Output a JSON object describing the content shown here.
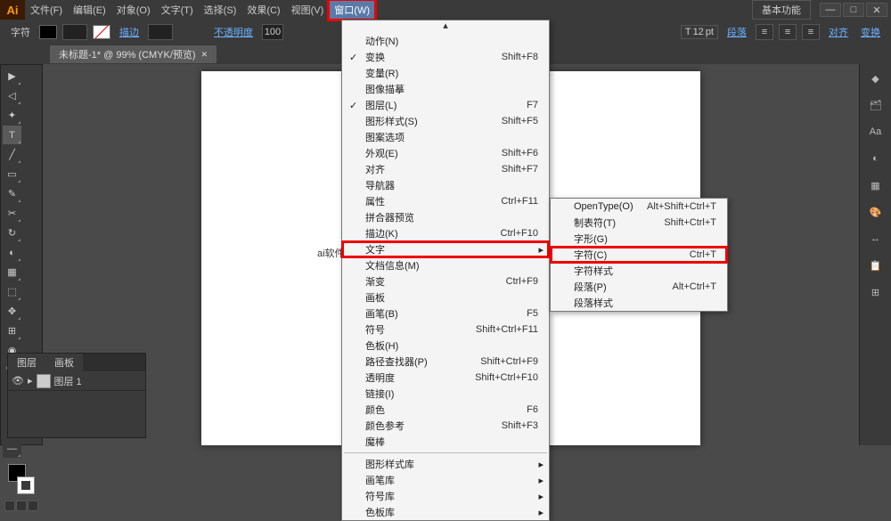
{
  "app": {
    "logo": "Ai",
    "essentials": "基本功能"
  },
  "menu": {
    "items": [
      "文件(F)",
      "编辑(E)",
      "对象(O)",
      "文字(T)",
      "选择(S)",
      "效果(C)",
      "视图(V)",
      "窗口(W)"
    ],
    "activeIndex": 7
  },
  "optionbar": {
    "charLabel": "字符",
    "strokeLabel": "描边",
    "opacityLabel": "不透明度",
    "opacityValue": "100",
    "fontSize": "12",
    "fontUnit": "pt",
    "paragraphLink": "段落",
    "alignLink": "对齐",
    "transformLink": "变换"
  },
  "doc": {
    "tabTitle": "未标题-1* @ 99% (CMYK/预览)",
    "canvasText": "ai软件的:"
  },
  "windowMenu": {
    "items": [
      {
        "label": "动作(N)"
      },
      {
        "label": "变换",
        "shortcut": "Shift+F8",
        "checked": true
      },
      {
        "label": "变量(R)"
      },
      {
        "label": "图像描摹"
      },
      {
        "label": "图层(L)",
        "shortcut": "F7",
        "checked": true
      },
      {
        "label": "图形样式(S)",
        "shortcut": "Shift+F5"
      },
      {
        "label": "图案选项"
      },
      {
        "label": "外观(E)",
        "shortcut": "Shift+F6"
      },
      {
        "label": "对齐",
        "shortcut": "Shift+F7"
      },
      {
        "label": "导航器"
      },
      {
        "label": "属性",
        "shortcut": "Ctrl+F11"
      },
      {
        "label": "拼合器预览"
      },
      {
        "label": "描边(K)",
        "shortcut": "Ctrl+F10"
      },
      {
        "label": "文字",
        "submenu": true,
        "highlight": true
      },
      {
        "label": "文档信息(M)"
      },
      {
        "label": "渐变",
        "shortcut": "Ctrl+F9"
      },
      {
        "label": "画板",
        "shortcut": ""
      },
      {
        "label": "画笔(B)",
        "shortcut": "F5"
      },
      {
        "label": "符号",
        "shortcut": "Shift+Ctrl+F11"
      },
      {
        "label": "色板(H)"
      },
      {
        "label": "路径查找器(P)",
        "shortcut": "Shift+Ctrl+F9"
      },
      {
        "label": "透明度",
        "shortcut": "Shift+Ctrl+F10"
      },
      {
        "label": "链接(I)"
      },
      {
        "label": "颜色",
        "shortcut": "F6"
      },
      {
        "label": "颜色参考",
        "shortcut": "Shift+F3"
      },
      {
        "label": "魔棒"
      }
    ],
    "libraries": [
      {
        "label": "图形样式库",
        "submenu": true
      },
      {
        "label": "画笔库",
        "submenu": true
      },
      {
        "label": "符号库",
        "submenu": true
      },
      {
        "label": "色板库",
        "submenu": true
      }
    ]
  },
  "textSubmenu": {
    "items": [
      {
        "label": "OpenType(O)",
        "shortcut": "Alt+Shift+Ctrl+T"
      },
      {
        "label": "制表符(T)",
        "shortcut": "Shift+Ctrl+T"
      },
      {
        "label": "字形(G)"
      },
      {
        "label": "字符(C)",
        "shortcut": "Ctrl+T",
        "highlight": true
      },
      {
        "label": "字符样式"
      },
      {
        "label": "段落(P)",
        "shortcut": "Alt+Ctrl+T"
      },
      {
        "label": "段落样式"
      }
    ]
  },
  "layers": {
    "tab1": "图层",
    "tab2": "画板",
    "row": "图层 1"
  }
}
